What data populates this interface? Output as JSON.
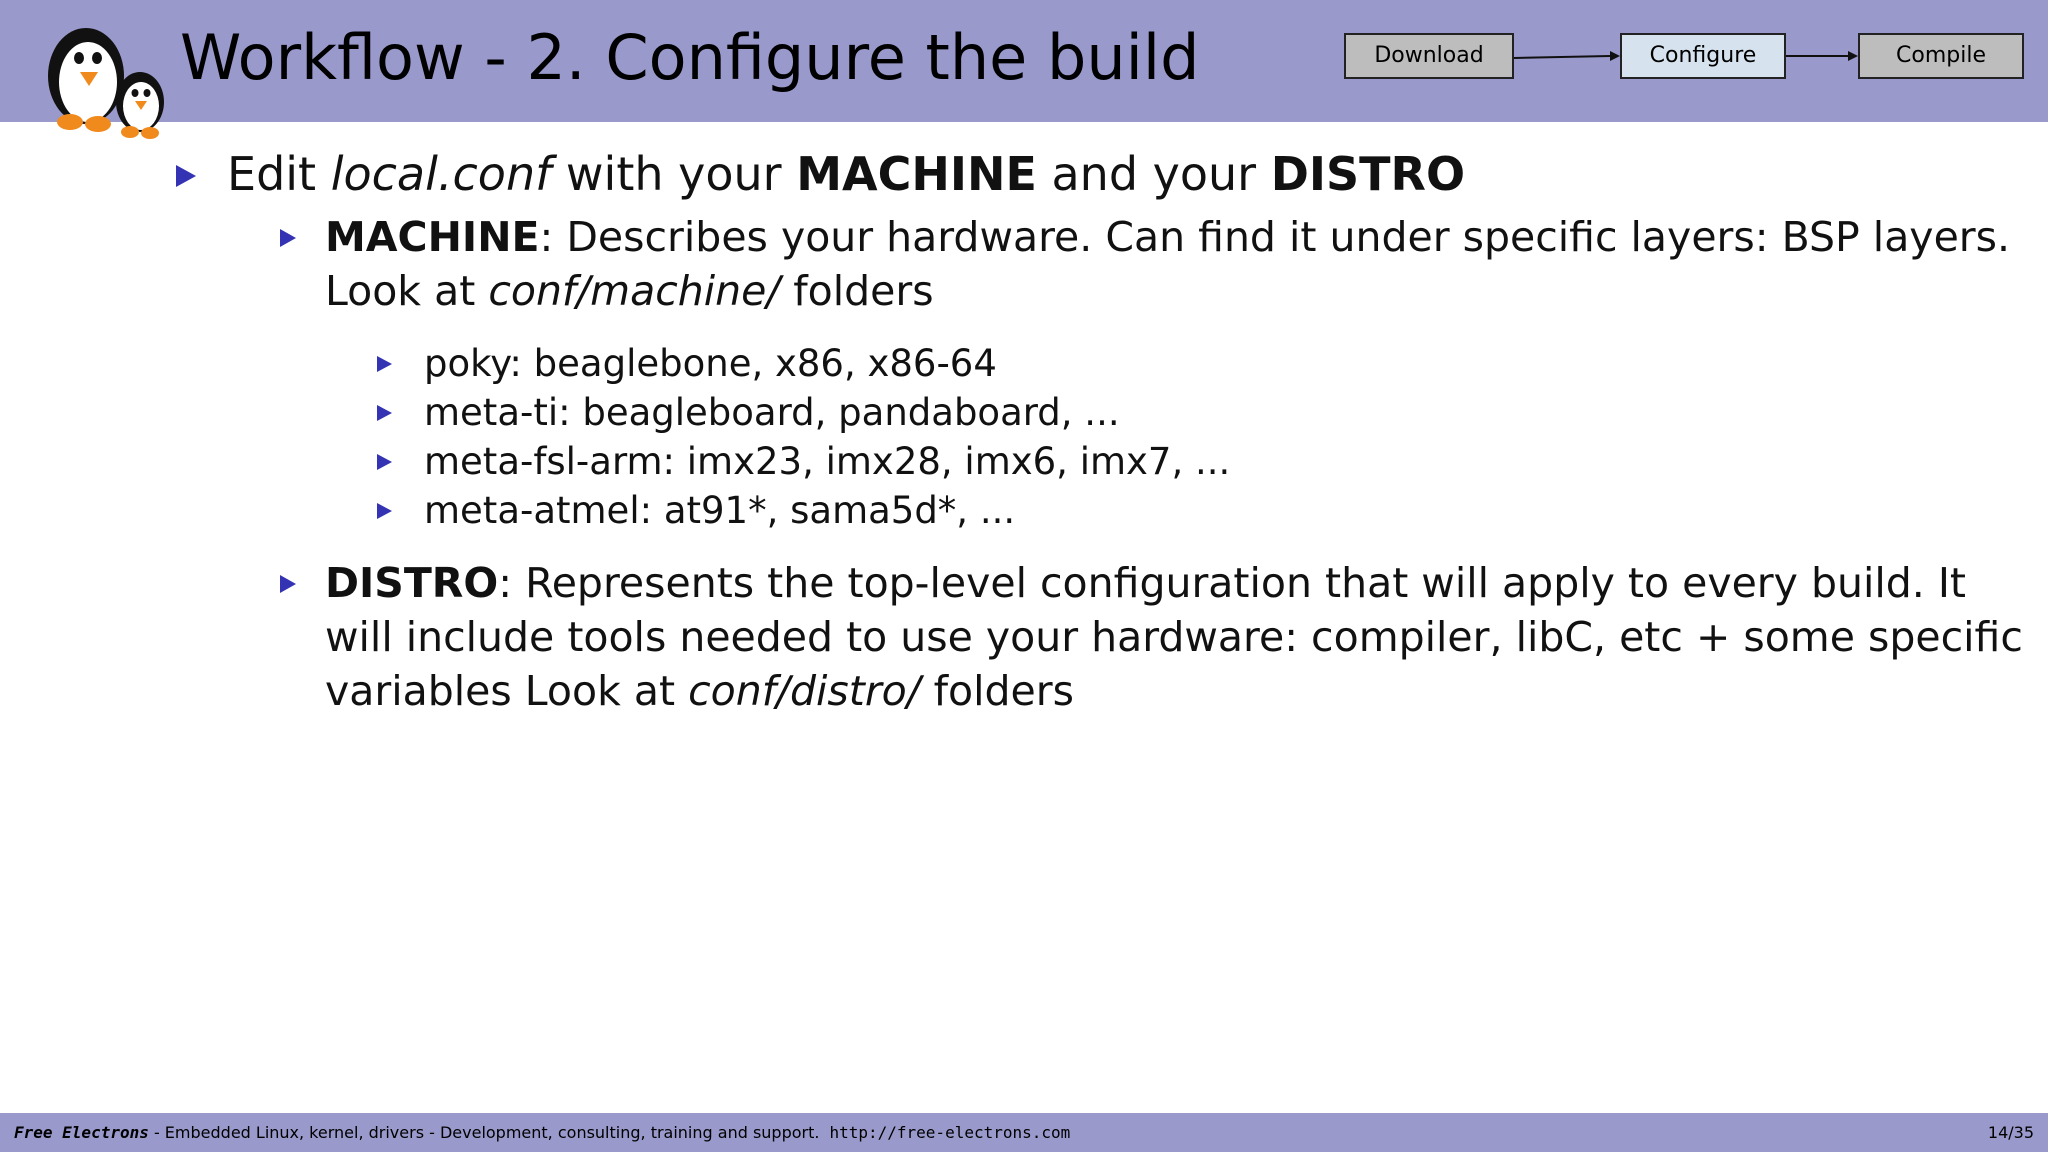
{
  "header": {
    "title": "Workflow - 2. Configure the build",
    "steps": [
      "Download",
      "Configure",
      "Compile"
    ],
    "active_step": "Configure"
  },
  "content": {
    "item1": {
      "pre": "Edit ",
      "file": "local.conf",
      "mid": " with your ",
      "kw1": "MACHINE",
      "and": " and your ",
      "kw2": "DISTRO"
    },
    "machine": {
      "kw": "MACHINE",
      "line1": ": Describes your hardware. Can find it under specific layers: BSP layers.",
      "line2_pre": "Look at ",
      "line2_path": "conf/machine/",
      "line2_post": " folders",
      "subitems": [
        "poky: beaglebone, x86, x86-64",
        "meta-ti: beagleboard, pandaboard, ...",
        "meta-fsl-arm: imx23, imx28, imx6, imx7, ...",
        "meta-atmel: at91*, sama5d*, ..."
      ]
    },
    "distro": {
      "kw": "DISTRO",
      "line1": ": Represents the top-level configuration that will apply to every build. It",
      "line2": "will include tools needed to use your hardware: compiler, libC, etc + some specific",
      "line3_pre": "variables Look at ",
      "line3_path": "conf/distro/",
      "line3_post": " folders"
    }
  },
  "footer": {
    "brand": "Free Electrons",
    "tagline": " - Embedded Linux, kernel, drivers - Development, consulting, training and support.",
    "url": "http://free-electrons.com",
    "page": "14/35"
  },
  "colors": {
    "bar": "#9999cc",
    "bullet": "#3333b3",
    "active_step": "#d6e3ee",
    "step": "#bdbdbd"
  }
}
